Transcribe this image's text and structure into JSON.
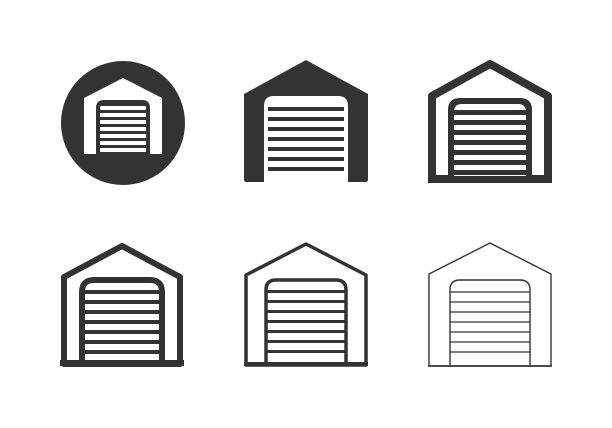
{
  "icon_set": {
    "ink_color": "#333333",
    "background_color": "#ffffff",
    "icons": [
      {
        "name": "garage-circle-icon",
        "style": "filled circle"
      },
      {
        "name": "garage-solid-icon",
        "style": "solid"
      },
      {
        "name": "garage-bold-outline-icon",
        "style": "bold outline"
      },
      {
        "name": "garage-medium-outline-icon",
        "style": "medium outline"
      },
      {
        "name": "garage-outline-icon",
        "style": "outline"
      },
      {
        "name": "garage-thin-outline-icon",
        "style": "thin outline"
      }
    ]
  }
}
